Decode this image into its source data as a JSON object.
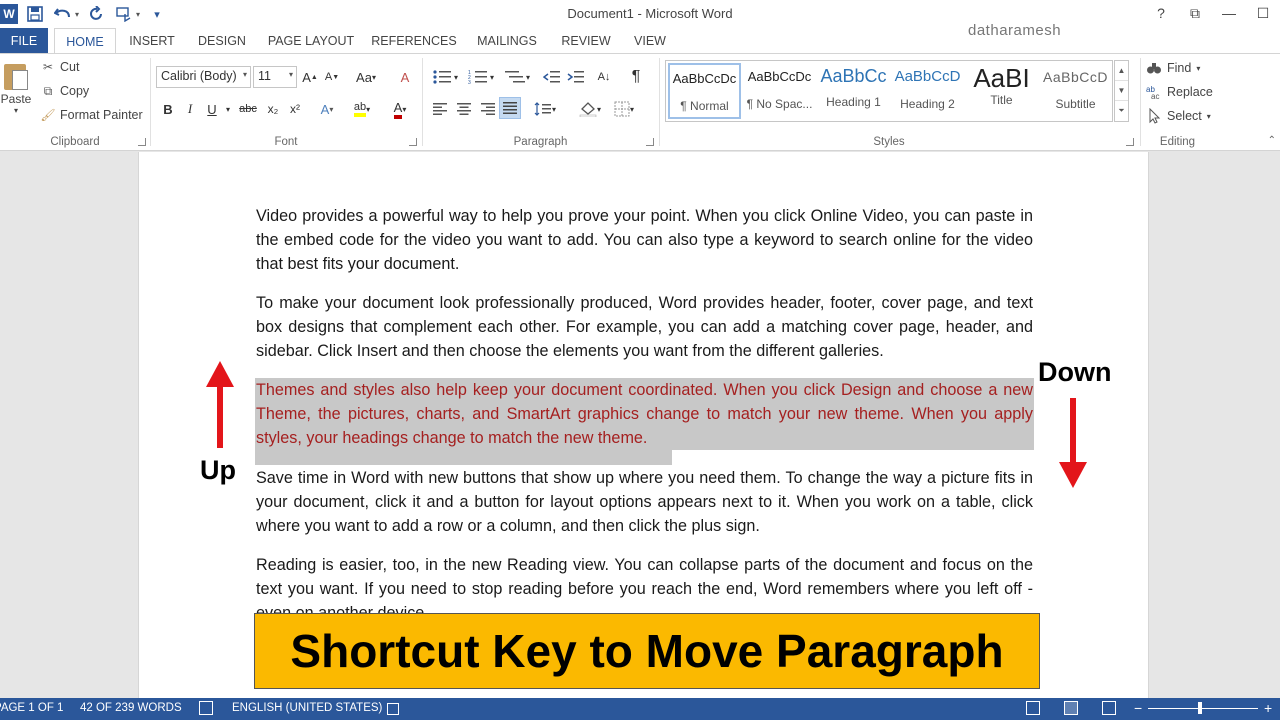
{
  "window": {
    "title": "Document1 - Microsoft Word",
    "user": "datharamesh",
    "controls": [
      "?",
      "⧉",
      "—",
      "☐"
    ]
  },
  "qat": {
    "logo": "W",
    "save_icon": "save-icon",
    "undo_icon": "undo-icon",
    "redo_icon": "redo-icon",
    "customize": "▾"
  },
  "tabs": [
    "FILE",
    "HOME",
    "INSERT",
    "DESIGN",
    "PAGE LAYOUT",
    "REFERENCES",
    "MAILINGS",
    "REVIEW",
    "VIEW"
  ],
  "ribbon": {
    "clipboard": {
      "paste": "Paste",
      "cut": "Cut",
      "copy": "Copy",
      "format_painter": "Format Painter",
      "label": "Clipboard"
    },
    "font": {
      "font_name": "Calibri (Body)",
      "font_size": "11",
      "grow": "A",
      "shrink": "A",
      "case": "Aa",
      "clear": "A",
      "bold": "B",
      "italic": "I",
      "underline": "U",
      "strike": "abc",
      "subscript": "x₂",
      "superscript": "x²",
      "text_effects": "A",
      "highlight": "ab",
      "font_color": "A",
      "label": "Font"
    },
    "paragraph": {
      "label": "Paragraph",
      "pilcrow": "¶",
      "sort": "A↓"
    },
    "styles": {
      "label": "Styles",
      "items": [
        {
          "sample": "AaBbCcDc",
          "name": "¶ Normal"
        },
        {
          "sample": "AaBbCcDc",
          "name": "¶ No Spac..."
        },
        {
          "sample": "AaBbCc",
          "name": "Heading 1"
        },
        {
          "sample": "AaBbCcD",
          "name": "Heading 2"
        },
        {
          "sample": "AaBI",
          "name": "Title"
        },
        {
          "sample": "AaBbCcD",
          "name": "Subtitle"
        }
      ]
    },
    "editing": {
      "find": "Find",
      "replace": "Replace",
      "select": "Select",
      "label": "Editing"
    }
  },
  "document": {
    "paragraphs": [
      "Video provides a powerful way to help you prove your point. When you click Online Video, you can paste in the embed code for the video you want to add. You can also type a keyword to search online for the video that best fits your document.",
      "To make your document look professionally produced, Word provides header, footer, cover page, and text box designs that complement each other. For example, you can add a matching cover page, header, and sidebar. Click Insert and then choose the elements you want from the different galleries.",
      "Themes and styles also help keep your document coordinated. When you click Design and choose a new Theme, the pictures, charts, and SmartArt graphics change to match your new theme. When you apply styles, your headings change to match the new theme.",
      "Save time in Word with new buttons that show up where you need them. To change the way a picture fits in your document, click it and a button for layout options appears next to it. When you work on a table, click where you want to add a row or a column, and then click the plus sign.",
      "Reading is easier, too, in the new Reading view. You can collapse parts of the document and focus on the text you want. If you need to stop reading before you reach the end, Word remembers where you left off - even on another device."
    ],
    "selected_paragraph_index": 2
  },
  "annotations": {
    "up": "Up",
    "down": "Down",
    "banner": "Shortcut Key to Move Paragraph"
  },
  "status": {
    "page": "PAGE 1 OF 1",
    "words": "42 OF 239 WORDS",
    "language": "ENGLISH (UNITED STATES)",
    "zoom_level": 0.47
  },
  "colors": {
    "accent": "#2b579a",
    "selection_text": "#a52020",
    "arrow": "#e3151a",
    "banner": "#fbb900"
  }
}
